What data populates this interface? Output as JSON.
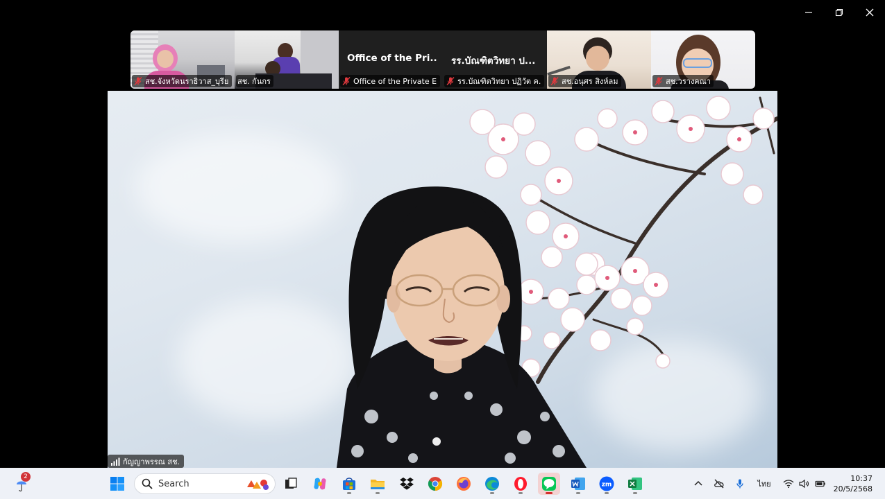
{
  "window": {
    "minimize_label": "minimize",
    "restore_label": "restore",
    "close_label": "close"
  },
  "thumbnails": [
    {
      "label": "สช.จังหวัดนราธิวาส_บุรีย...",
      "muted": true,
      "type": "video"
    },
    {
      "label": "สช. กันกร",
      "muted": false,
      "type": "video"
    },
    {
      "title": "Office of the Pri...",
      "label": "Office of the Private E...",
      "muted": true,
      "type": "text"
    },
    {
      "title": "รร.บัณฑิตวิทยา ป...",
      "label": "รร.บัณฑิตวิทยา ปฏิวัต ค...",
      "muted": true,
      "type": "text"
    },
    {
      "label": "สช.อนุศร สิงห์ลม",
      "muted": true,
      "type": "video"
    },
    {
      "label": "สช.วรางคณา",
      "muted": true,
      "type": "video"
    }
  ],
  "main_video": {
    "speaker_label": "กัญญาพรรณ สช.",
    "background": "cherry-blossom-sky"
  },
  "taskbar": {
    "weather_badge": "2",
    "search_placeholder": "Search",
    "apps": [
      "start-icon",
      "copilot-icon",
      "store-icon",
      "file-explorer-icon",
      "dropbox-icon",
      "chrome-icon",
      "firefox-icon",
      "edge-icon",
      "opera-icon",
      "line-icon",
      "word-icon",
      "zoom-icon",
      "excel-icon"
    ],
    "language": "ไทย",
    "time": "10:37",
    "date": "20/5/2568"
  },
  "colors": {
    "taskbar_bg": "#eef1f7",
    "muted_mic": "#e0393e",
    "accent_line": "#06c755",
    "zoom_blue": "#0b5cff"
  }
}
